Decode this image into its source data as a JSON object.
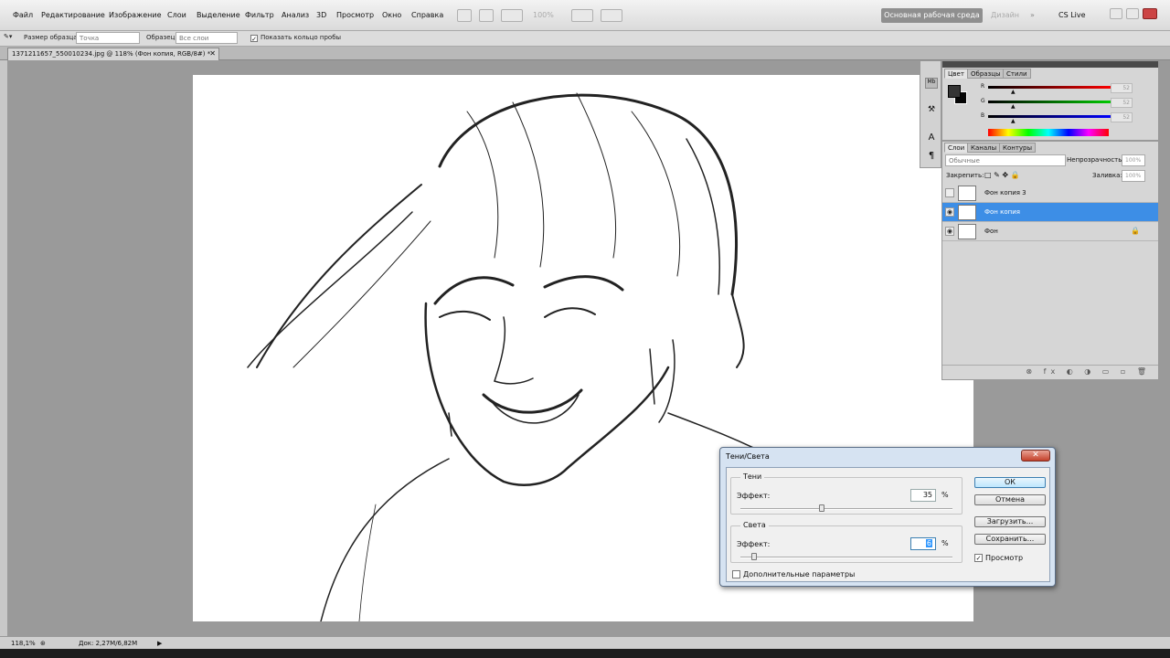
{
  "menu": [
    "Файл",
    "Редактирование",
    "Изображение",
    "Слои",
    "Выделение",
    "Фильтр",
    "Анализ",
    "3D",
    "Просмотр",
    "Окно",
    "Справка"
  ],
  "zoom_menu": "100%",
  "workspace": {
    "active": "Основная рабочая среда",
    "other": "Дизайн",
    "cs_live": "CS Live"
  },
  "options": {
    "sample_size_label": "Размер образца:",
    "sample_size_value": "Точка",
    "sample_label": "Образец:",
    "sample_value": "Все слои",
    "show_ring": "Показать кольцо пробы"
  },
  "document_tab": "1371211657_550010234.jpg @ 118% (Фон копия, RGB/8#) *",
  "color_panel": {
    "tabs": [
      "Цвет",
      "Образцы",
      "Стили"
    ],
    "channels": [
      {
        "name": "R",
        "value": "52"
      },
      {
        "name": "G",
        "value": "52"
      },
      {
        "name": "B",
        "value": "52"
      }
    ]
  },
  "layers_panel": {
    "tabs": [
      "Слои",
      "Каналы",
      "Контуры"
    ],
    "blend_mode": "Обычные",
    "opacity_label": "Непрозрачность:",
    "opacity_value": "100%",
    "lock_label": "Закрепить:",
    "fill_label": "Заливка:",
    "fill_value": "100%",
    "layers": [
      {
        "name": "Фон копия 3",
        "visible": false,
        "selected": false,
        "locked": false
      },
      {
        "name": "Фон копия",
        "visible": true,
        "selected": true,
        "locked": false
      },
      {
        "name": "Фон",
        "visible": true,
        "selected": false,
        "locked": true
      }
    ]
  },
  "status": {
    "zoom": "118,1%",
    "doc": "Док: 2,27M/6,82M"
  },
  "dialog": {
    "title": "Тени/Света",
    "shadows": {
      "title": "Тени",
      "effect_label": "Эффект:",
      "value": "35",
      "unit": "%",
      "level": 0.35
    },
    "highlights": {
      "title": "Света",
      "effect_label": "Эффект:",
      "value": "6",
      "unit": "%",
      "level": 0.06
    },
    "more_options": "Дополнительные параметры",
    "buttons": {
      "ok": "ОК",
      "cancel": "Отмена",
      "load": "Загрузить...",
      "save": "Сохранить..."
    },
    "preview": "Просмотр"
  },
  "colors": {
    "selection": "#3d8ee6"
  }
}
